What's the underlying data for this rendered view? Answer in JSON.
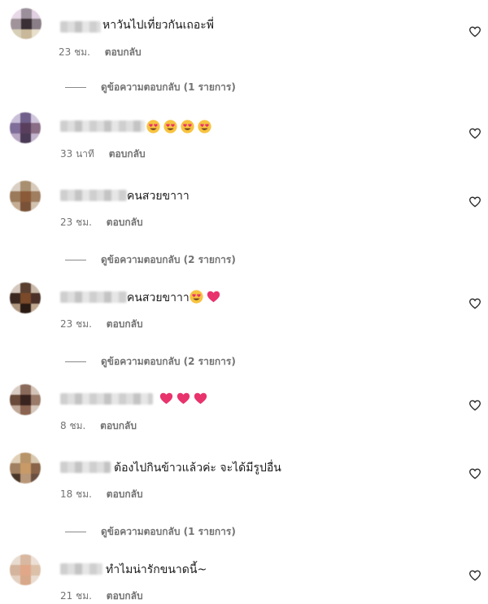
{
  "reply_label": "ตอบกลับ",
  "comments": [
    {
      "text": "หาวันไปเที่ยวกันเถอะพี่",
      "time": "23 ชม.",
      "replies": "ดูข้อความตอบกลับ (1 รายการ)"
    },
    {
      "text": "",
      "emojis": [
        "heart-eyes-emoji",
        "heart-eyes-emoji",
        "heart-eyes-emoji",
        "heart-eyes-emoji"
      ],
      "time": "33 นาที"
    },
    {
      "text": "คนสวยขาาา",
      "time": "23 ชม.",
      "replies": "ดูข้อความตอบกลับ (2 รายการ)"
    },
    {
      "text": "คนสวยขาาา",
      "emojis": [
        "heart-eyes-emoji",
        "pink-heart-emoji"
      ],
      "time": "23 ชม.",
      "replies": "ดูข้อความตอบกลับ (2 รายการ)"
    },
    {
      "text": "",
      "emojis": [
        "pink-heart-emoji",
        "pink-heart-emoji",
        "pink-heart-emoji"
      ],
      "time": "8 ชม."
    },
    {
      "text": "ต้องไปกินข้าวแล้วค่ะ จะได้มีรูปอื่น",
      "time": "18 ชม.",
      "replies": "ดูข้อความตอบกลับ (1 รายการ)"
    },
    {
      "text": "ทำไมน่ารักขนาดนี้~",
      "time": "21 ชม."
    }
  ],
  "colors": {
    "text": "#262626",
    "meta": "#737373",
    "heart_emoji": "#e8336d"
  },
  "icons": {
    "like": "heart-outline-icon"
  }
}
